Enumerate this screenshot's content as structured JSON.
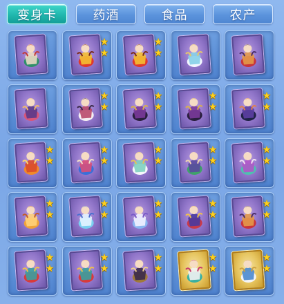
{
  "tabs": [
    {
      "label": "变身卡",
      "active": true
    },
    {
      "label": "药酒",
      "active": false
    },
    {
      "label": "食品",
      "active": false
    },
    {
      "label": "农产",
      "active": false
    }
  ],
  "colors": {
    "tab_active": "#20b7ad",
    "tab_inactive": "#5b93dc",
    "card_purple": "#8f74c8",
    "card_gold": "#e6c45e",
    "star": "#ffd21c"
  },
  "items": [
    {
      "name": "green-robed-swordsman-card",
      "rarity": "purple",
      "stars": 0,
      "palette": [
        "#2f8f6a",
        "#e9d9c2",
        "#c23a3a"
      ]
    },
    {
      "name": "red-lion-dragon-card",
      "rarity": "purple",
      "stars": 2,
      "palette": [
        "#e0392b",
        "#f4c033",
        "#7a2a1a"
      ]
    },
    {
      "name": "red-lion-dragon-card",
      "rarity": "purple",
      "stars": 2,
      "palette": [
        "#e0392b",
        "#f4c033",
        "#7a2a1a"
      ]
    },
    {
      "name": "white-cloud-spirit-card",
      "rarity": "purple",
      "stars": 0,
      "palette": [
        "#f2f6ff",
        "#86d0e8",
        "#e6c76a"
      ]
    },
    {
      "name": "red-armored-warrior-card",
      "rarity": "purple",
      "stars": 0,
      "palette": [
        "#c8353b",
        "#e39a4a",
        "#4b2f6b"
      ]
    },
    {
      "name": "pink-beast-rider-card",
      "rarity": "purple",
      "stars": 0,
      "palette": [
        "#d9567a",
        "#5a3a8a",
        "#f2b86c"
      ]
    },
    {
      "name": "winged-dancer-card",
      "rarity": "purple",
      "stars": 2,
      "palette": [
        "#f4eef2",
        "#b94a6b",
        "#3a2a4a"
      ]
    },
    {
      "name": "dark-horse-knight-card",
      "rarity": "purple",
      "stars": 2,
      "palette": [
        "#2a1f3e",
        "#7a3a9a",
        "#d9b04a"
      ]
    },
    {
      "name": "dark-horse-knight-card",
      "rarity": "purple",
      "stars": 2,
      "palette": [
        "#2a1f3e",
        "#7a3a9a",
        "#d9b04a"
      ]
    },
    {
      "name": "shadow-beast-rider-card",
      "rarity": "purple",
      "stars": 2,
      "palette": [
        "#1f2346",
        "#5c3fa3",
        "#e0804a"
      ]
    },
    {
      "name": "flame-tiger-card",
      "rarity": "purple",
      "stars": 2,
      "palette": [
        "#f08a2a",
        "#d94a2a",
        "#ffd76a"
      ]
    },
    {
      "name": "blue-haired-sage-card",
      "rarity": "purple",
      "stars": 2,
      "palette": [
        "#3a6fd9",
        "#d94f7a",
        "#f4e0c8"
      ]
    },
    {
      "name": "white-crane-immortal-card",
      "rarity": "purple",
      "stars": 2,
      "palette": [
        "#f5f7fb",
        "#7fd0c0",
        "#e6c35a"
      ]
    },
    {
      "name": "green-robed-scholar-card",
      "rarity": "purple",
      "stars": 2,
      "palette": [
        "#3fa26a",
        "#5a4aa0",
        "#f0d6b0"
      ]
    },
    {
      "name": "butterfly-fairy-card",
      "rarity": "purple",
      "stars": 2,
      "palette": [
        "#4fc0b0",
        "#b056c8",
        "#f2e2f2"
      ]
    },
    {
      "name": "golden-fox-card",
      "rarity": "purple",
      "stars": 2,
      "palette": [
        "#f0a23a",
        "#ffd27a",
        "#c25a2a"
      ]
    },
    {
      "name": "ice-phoenix-card",
      "rarity": "purple",
      "stars": 2,
      "palette": [
        "#7ad0f0",
        "#e6f4ff",
        "#4a6fd0"
      ]
    },
    {
      "name": "blue-spirit-maiden-card",
      "rarity": "purple",
      "stars": 2,
      "palette": [
        "#8ab6f0",
        "#f2f2ff",
        "#7a5ac8"
      ]
    },
    {
      "name": "phoenix-warrior-card",
      "rarity": "purple",
      "stars": 2,
      "palette": [
        "#c83a4a",
        "#4a3aa0",
        "#f0c04a"
      ]
    },
    {
      "name": "red-armored-warrior-card",
      "rarity": "purple",
      "stars": 2,
      "palette": [
        "#c8353b",
        "#e39a4a",
        "#4b2f6b"
      ]
    },
    {
      "name": "red-dragon-serpent-card",
      "rarity": "purple",
      "stars": 2,
      "palette": [
        "#d93a3a",
        "#3aa0a0",
        "#f0c04a"
      ]
    },
    {
      "name": "red-dragon-serpent-card",
      "rarity": "purple",
      "stars": 2,
      "palette": [
        "#d93a3a",
        "#3aa0a0",
        "#f0c04a"
      ]
    },
    {
      "name": "golden-armored-general-card",
      "rarity": "purple",
      "stars": 2,
      "palette": [
        "#a07a3a",
        "#3a2a4a",
        "#f0d08a"
      ]
    },
    {
      "name": "jade-fairy-gold-card",
      "rarity": "gold",
      "stars": 2,
      "palette": [
        "#3ab0a0",
        "#f2f2f2",
        "#c83a6a"
      ]
    },
    {
      "name": "white-sage-gold-card",
      "rarity": "gold",
      "stars": 2,
      "palette": [
        "#f4f4f4",
        "#4a8ad0",
        "#d0a040"
      ]
    }
  ]
}
